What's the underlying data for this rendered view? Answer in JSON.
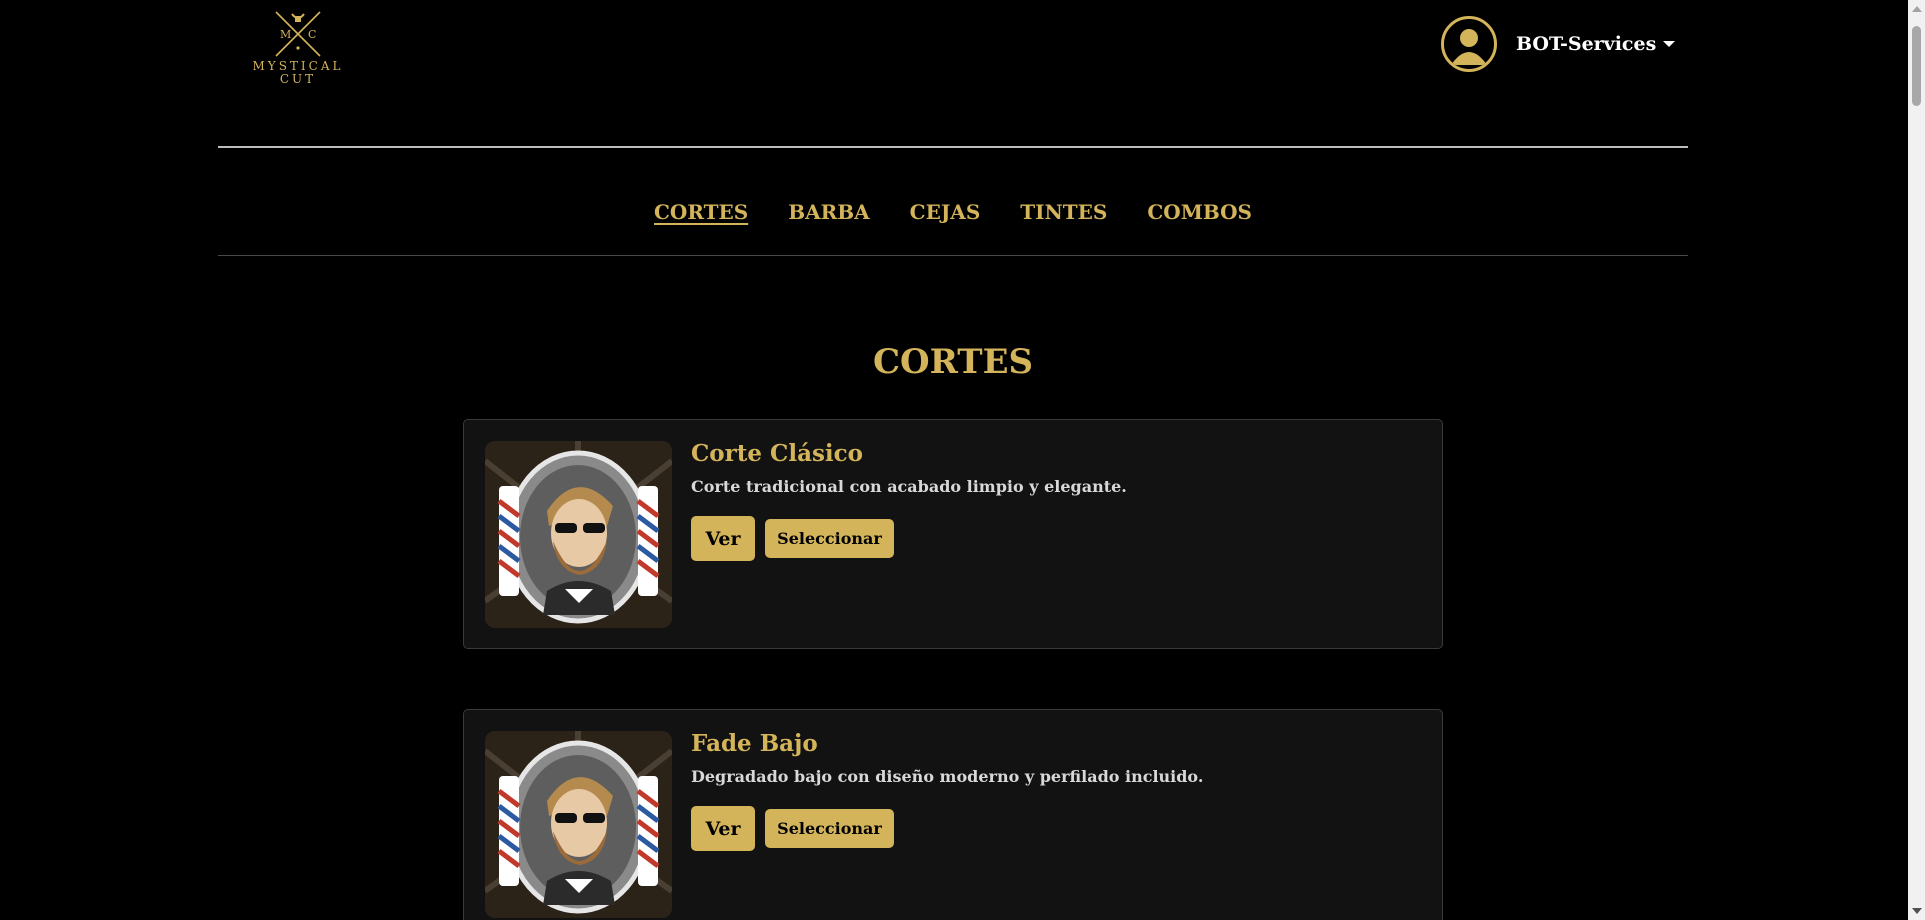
{
  "brand": {
    "logo_letters": "M C",
    "logo_text_line1": "MYSTICAL",
    "logo_text_line2": "CUT",
    "accent_color": "#d4b45a"
  },
  "header": {
    "user_name": "BOT-Services",
    "avatar_icon": "user-avatar-icon",
    "dropdown_icon": "caret-down-icon"
  },
  "nav": {
    "items": [
      {
        "label": "CORTES",
        "active": true
      },
      {
        "label": "BARBA",
        "active": false
      },
      {
        "label": "CEJAS",
        "active": false
      },
      {
        "label": "TINTES",
        "active": false
      },
      {
        "label": "COMBOS",
        "active": false
      }
    ]
  },
  "section": {
    "title": "CORTES",
    "services": [
      {
        "title": "Corte Clásico",
        "description": "Corte tradicional con acabado limpio y elegante.",
        "view_label": "Ver",
        "select_label": "Seleccionar",
        "image_icon": "barber-emblem-icon"
      },
      {
        "title": "Fade Bajo",
        "description": "Degradado bajo con diseño moderno y perfilado incluido.",
        "view_label": "Ver",
        "select_label": "Seleccionar",
        "image_icon": "barber-emblem-icon"
      }
    ]
  }
}
